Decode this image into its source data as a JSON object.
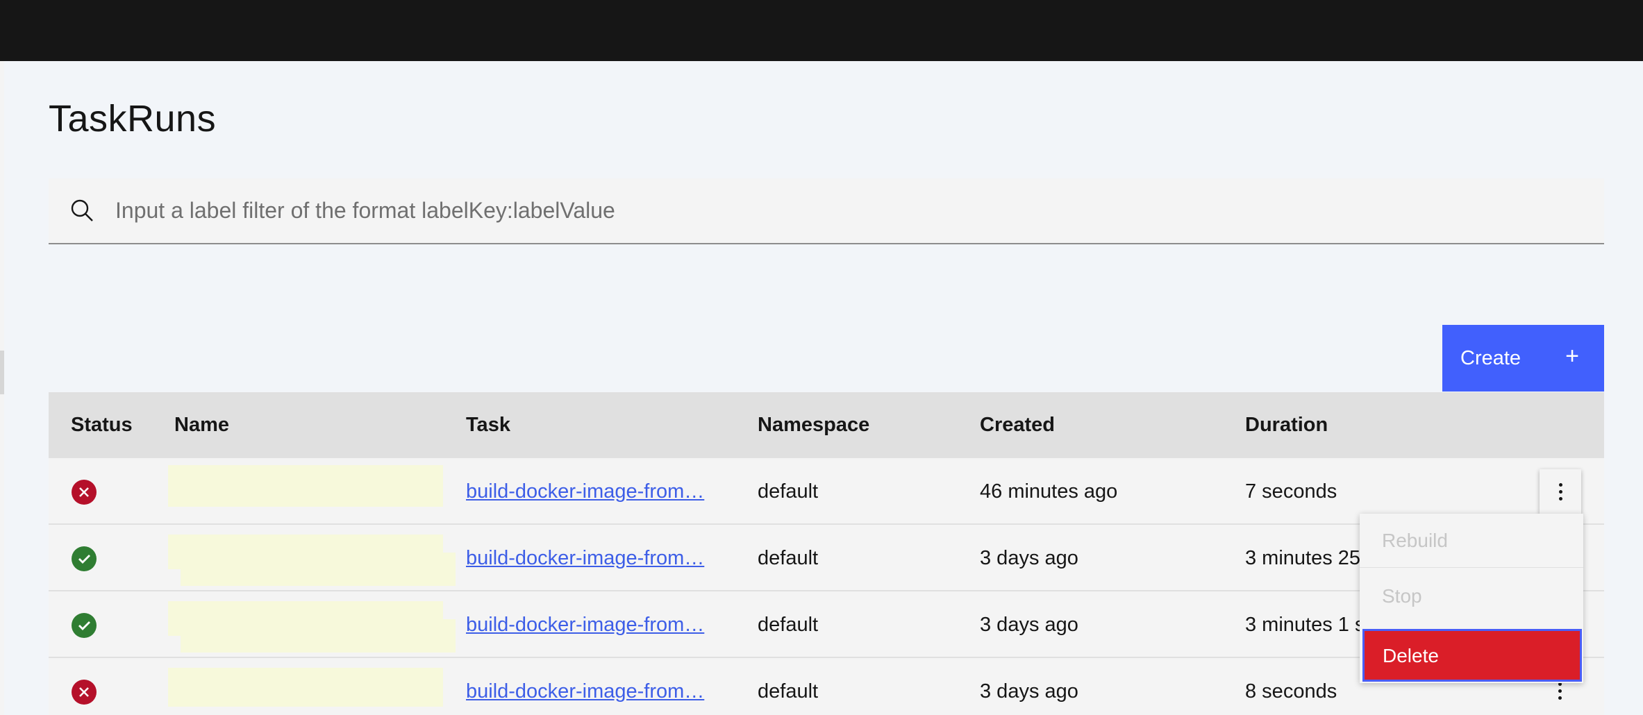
{
  "page": {
    "title": "TaskRuns"
  },
  "search": {
    "placeholder": "Input a label filter of the format labelKey:labelValue",
    "icon": "search-icon"
  },
  "toolbar": {
    "create_label": "Create",
    "create_icon": "+"
  },
  "table": {
    "columns": [
      "Status",
      "Name",
      "Task",
      "Namespace",
      "Created",
      "Duration"
    ],
    "rows": [
      {
        "status": "failed",
        "name": "",
        "task": "build-docker-image-from…",
        "namespace": "default",
        "created": "46 minutes ago",
        "duration": "7 seconds"
      },
      {
        "status": "succeeded",
        "name": "",
        "task": "build-docker-image-from…",
        "namespace": "default",
        "created": "3 days ago",
        "duration": "3 minutes 25"
      },
      {
        "status": "succeeded",
        "name": "",
        "task": "build-docker-image-from…",
        "namespace": "default",
        "created": "3 days ago",
        "duration": "3 minutes 1 s"
      },
      {
        "status": "failed",
        "name": "",
        "task": "build-docker-image-from…",
        "namespace": "default",
        "created": "3 days ago",
        "duration": "8 seconds"
      }
    ]
  },
  "overflow_menu": {
    "items": [
      "Rebuild",
      "Stop",
      "Delete"
    ]
  },
  "colors": {
    "primary": "#4160fd",
    "danger": "#da1e28",
    "success": "#2f7d32",
    "error": "#b5102a",
    "link": "#3d5ee7",
    "topbar": "#161616"
  }
}
